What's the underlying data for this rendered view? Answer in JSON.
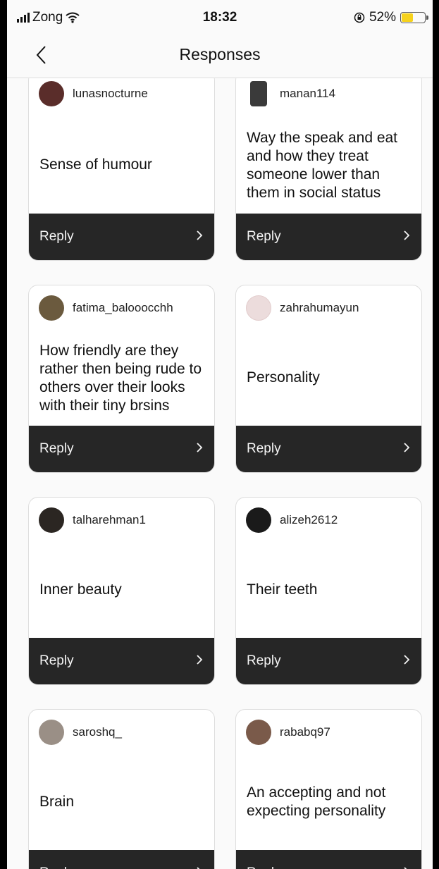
{
  "status_bar": {
    "carrier": "Zong",
    "time": "18:32",
    "battery": "52%",
    "battery_level": 0.52
  },
  "header": {
    "title": "Responses"
  },
  "reply_label": "Reply",
  "cards": [
    {
      "username": "lunasnocturne",
      "answer": "Sense of humour",
      "avatar_color": "#5a2d2a"
    },
    {
      "username": "manan114",
      "answer": "Way the speak and eat and how they treat someone lower than them in social status",
      "avatar_color": "#3a3a3a"
    },
    {
      "username": "fatima_balooocchh",
      "answer": "How friendly are they rather then being rude to others over their looks with their tiny brsins",
      "avatar_color": "#6b5a3e"
    },
    {
      "username": "zahrahumayun",
      "answer": "Personality",
      "avatar_color": "#ecdcdc"
    },
    {
      "username": "talharehman1",
      "answer": "Inner beauty",
      "avatar_color": "#2b2622"
    },
    {
      "username": "alizeh2612",
      "answer": "Their teeth",
      "avatar_color": "#1a1a1a"
    },
    {
      "username": "saroshq_",
      "answer": "Brain",
      "avatar_color": "#9a8f86"
    },
    {
      "username": "rababq97",
      "answer": "An accepting and not expecting personality",
      "avatar_color": "#7a5a4a"
    }
  ]
}
